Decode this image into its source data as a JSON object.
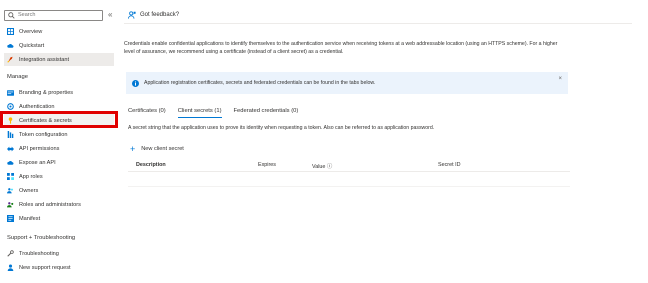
{
  "sidebar": {
    "search_placeholder": "Search",
    "collapse_glyph": "«",
    "items_top": [
      {
        "label": "Overview",
        "icon": "grid-icon"
      },
      {
        "label": "Quickstart",
        "icon": "cloud-icon"
      },
      {
        "label": "Integration assistant",
        "icon": "rocket-icon"
      }
    ],
    "section_manage": "Manage",
    "items_manage": [
      {
        "label": "Branding & properties",
        "icon": "branding-icon"
      },
      {
        "label": "Authentication",
        "icon": "auth-icon"
      },
      {
        "label": "Certificates & secrets",
        "icon": "key-icon"
      },
      {
        "label": "Token configuration",
        "icon": "token-icon"
      },
      {
        "label": "API permissions",
        "icon": "permissions-icon"
      },
      {
        "label": "Expose an API",
        "icon": "cloud-api-icon"
      },
      {
        "label": "App roles",
        "icon": "app-roles-icon"
      },
      {
        "label": "Owners",
        "icon": "owners-icon"
      },
      {
        "label": "Roles and administrators",
        "icon": "roles-icon"
      },
      {
        "label": "Manifest",
        "icon": "manifest-icon"
      }
    ],
    "section_support": "Support + Troubleshooting",
    "items_support": [
      {
        "label": "Troubleshooting",
        "icon": "wrench-icon"
      },
      {
        "label": "New support request",
        "icon": "support-icon"
      }
    ]
  },
  "main": {
    "feedback_label": "Got feedback?",
    "intro": "Credentials enable confidential applications to identify themselves to the authentication service when receiving tokens at a web addressable location (using an HTTPS scheme). For a higher level of assurance, we recommend using a certificate (instead of a client secret) as a credential.",
    "info_text": "Application registration certificates, secrets and federated credentials can be found in the tabs below.",
    "info_close": "×",
    "tabs": [
      {
        "label": "Certificates (0)"
      },
      {
        "label": "Client secrets (1)"
      },
      {
        "label": "Federated credentials (0)"
      }
    ],
    "tab_desc": "A secret string that the application uses to prove its identity when requesting a token. Also can be referred to as application password.",
    "new_secret_label": "New client secret",
    "columns": {
      "description": "Description",
      "expires": "Expires",
      "value": "Value ⓘ",
      "secret_id": "Secret ID"
    }
  },
  "colors": {
    "accent": "#0078d4",
    "highlight": "#e00000",
    "info_bg": "#ebf3fc"
  }
}
